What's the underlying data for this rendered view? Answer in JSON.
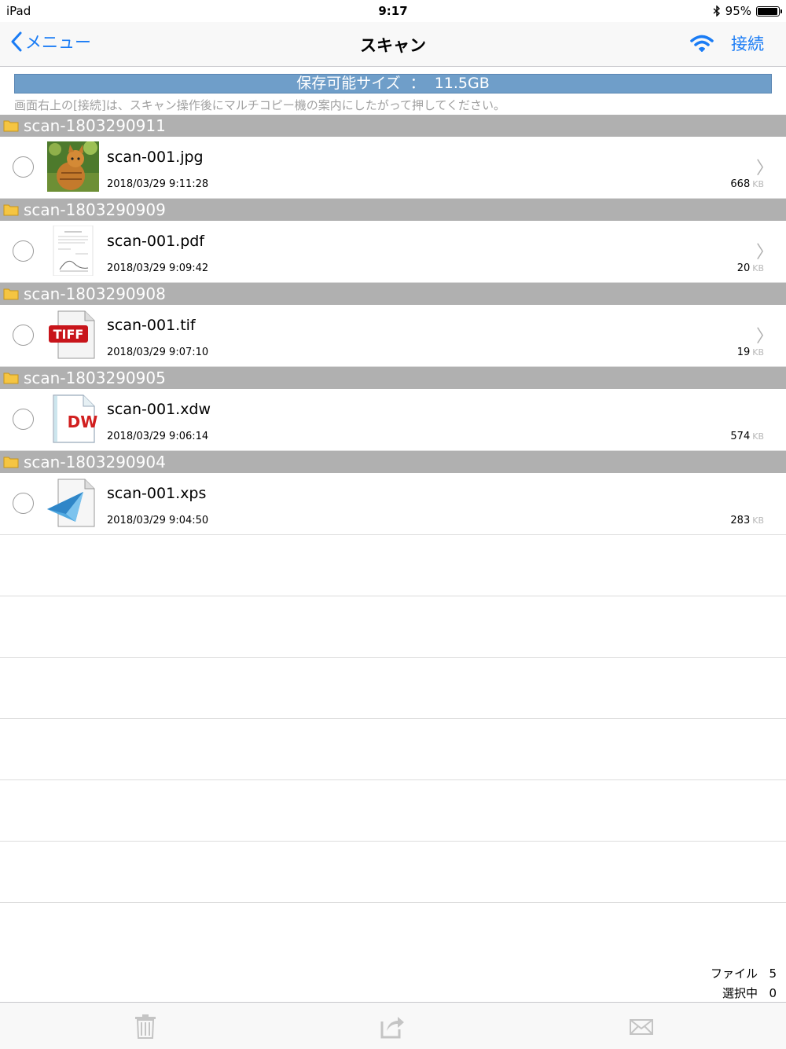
{
  "status_bar": {
    "device": "iPad",
    "time": "9:17",
    "battery_percent": "95%",
    "battery_level": 0.95
  },
  "nav": {
    "back_label": "メニュー",
    "title": "スキャン",
    "connect_label": "接続"
  },
  "storage": {
    "label": "保存可能サイズ",
    "separator": "：",
    "value": "11.5GB"
  },
  "hint": "画面右上の[接続]は、スキャン操作後にマルチコピー機の案内にしたがって押してください。",
  "sections": [
    {
      "folder": "scan-1803290911",
      "file": {
        "name": "scan-001.jpg",
        "date": "2018/03/29 9:11:28",
        "size": "668",
        "unit": "KB",
        "thumb": "cat-photo-thumbnail",
        "chevron": "〉"
      }
    },
    {
      "folder": "scan-1803290909",
      "file": {
        "name": "scan-001.pdf",
        "date": "2018/03/29 9:09:42",
        "size": "20",
        "unit": "KB",
        "thumb": "pdf-page-thumbnail",
        "chevron": "〉"
      }
    },
    {
      "folder": "scan-1803290908",
      "file": {
        "name": "scan-001.tif",
        "date": "2018/03/29 9:07:10",
        "size": "19",
        "unit": "KB",
        "thumb": "tiff-file-icon",
        "thumb_text": "TIFF",
        "chevron": "〉"
      }
    },
    {
      "folder": "scan-1803290905",
      "file": {
        "name": "scan-001.xdw",
        "date": "2018/03/29 9:06:14",
        "size": "574",
        "unit": "KB",
        "thumb": "docuworks-file-icon",
        "thumb_text": "DW"
      }
    },
    {
      "folder": "scan-1803290904",
      "file": {
        "name": "scan-001.xps",
        "date": "2018/03/29 9:04:50",
        "size": "283",
        "unit": "KB",
        "thumb": "xps-file-icon"
      }
    }
  ],
  "counts": {
    "files_label": "ファイル",
    "files_value": "5",
    "selected_label": "選択中",
    "selected_value": "0"
  },
  "toolbar": {
    "delete": "trash-icon",
    "share": "share-icon",
    "mail": "mail-icon"
  },
  "colors": {
    "accent": "#1a7cf5",
    "section_bg": "#b0b0b0",
    "storage_bar": "#6f9ec9",
    "folder": "#f5c542"
  }
}
